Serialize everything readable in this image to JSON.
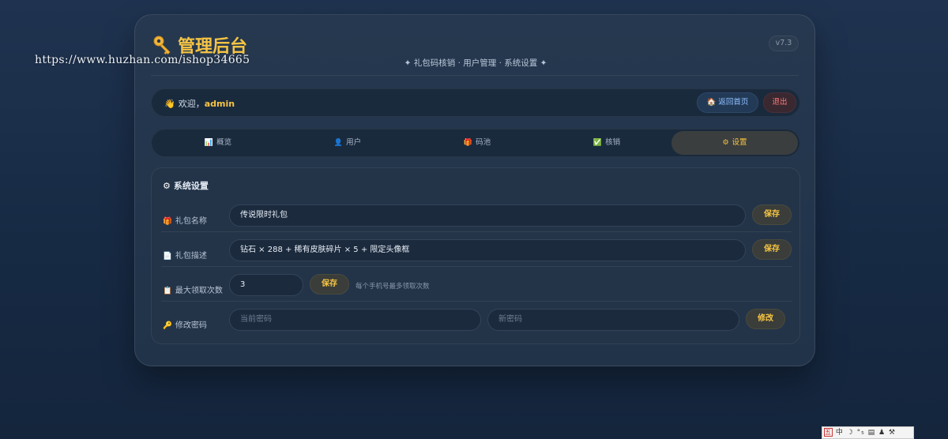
{
  "watermark": "https://www.huzhan.com/ishop34665",
  "header": {
    "title": "管理后台",
    "subtitle": "✦ 礼包码核销 · 用户管理 · 系统设置 ✦",
    "version": "v7.3"
  },
  "welcome": {
    "prefix": "欢迎，",
    "username": "admin",
    "home_button": "🏠 返回首页",
    "logout_button": "退出"
  },
  "tabs": [
    {
      "icon": "📊",
      "label": "概览",
      "active": false
    },
    {
      "icon": "👤",
      "label": "用户",
      "active": false
    },
    {
      "icon": "🎁",
      "label": "码池",
      "active": false
    },
    {
      "icon": "✅",
      "label": "核销",
      "active": false
    },
    {
      "icon": "⚙",
      "label": "设置",
      "active": true
    }
  ],
  "settings": {
    "title": "系统设置",
    "rows": [
      {
        "icon": "🎁",
        "label": "礼包名称",
        "value": "传说限时礼包",
        "button": "保存"
      },
      {
        "icon": "📄",
        "label": "礼包描述",
        "value": "钻石 × 288 + 稀有皮肤碎片 × 5 + 限定头像框",
        "button": "保存"
      },
      {
        "icon": "📋",
        "label": "最大领取次数",
        "value": "3",
        "button": "保存",
        "hint": "每个手机号最多领取次数"
      },
      {
        "icon": "🔑",
        "label": "修改密码",
        "placeholder_current": "当前密码",
        "placeholder_new": "新密码",
        "button": "修改"
      }
    ]
  },
  "tray": {
    "text": "中 ☽ °₅ ▤ ♟ ⚒"
  },
  "colors": {
    "accent": "#f5c444",
    "background": "#1f3350",
    "card": "#26384f",
    "danger": "#ff7b7b",
    "link": "#8fc0ff"
  }
}
